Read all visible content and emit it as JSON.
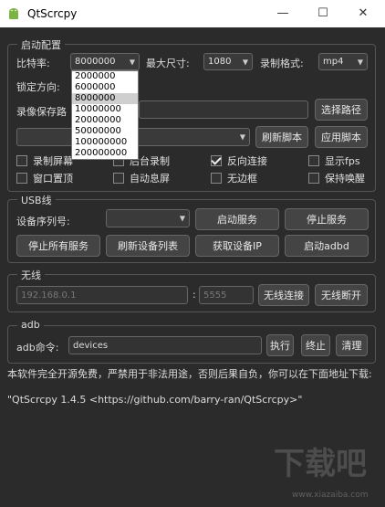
{
  "window": {
    "title": "QtScrcpy",
    "minimize": "—",
    "maximize": "☐",
    "close": "✕"
  },
  "start_group": {
    "label": "启动配置",
    "bitrate_label": "比特率:",
    "bitrate_value": "8000000",
    "bitrate_options": [
      "2000000",
      "6000000",
      "8000000",
      "10000000",
      "20000000",
      "50000000",
      "100000000",
      "200000000"
    ],
    "max_size_label": "最大尺寸:",
    "max_size_value": "1080",
    "record_format_label": "录制格式:",
    "record_format_value": "mp4",
    "lock_direction_label": "锁定方向:",
    "record_path_label": "录像保存路",
    "select_path_button": "选择路径",
    "refresh_script_button": "刷新脚本",
    "apply_script_button": "应用脚本",
    "checkboxes": {
      "record_screen": "录制屏幕",
      "background_record": "后台录制",
      "reverse_connect": "反向连接",
      "show_fps": "显示fps",
      "window_top": "窗口置顶",
      "auto_screen_off": "自动息屏",
      "frameless": "无边框",
      "keep_awake": "保持唤醒"
    }
  },
  "usb_group": {
    "label": "USB线",
    "serial_label": "设备序列号:",
    "start_service": "启动服务",
    "stop_service": "停止服务",
    "stop_all": "停止所有服务",
    "refresh_devices": "刷新设备列表",
    "get_ip": "获取设备IP",
    "start_adbd": "启动adbd"
  },
  "wireless_group": {
    "label": "无线",
    "ip_placeholder": "192.168.0.1",
    "colon": ":",
    "port_placeholder": "5555",
    "connect": "无线连接",
    "disconnect": "无线断开"
  },
  "adb_group": {
    "label": "adb",
    "command_label": "adb命令:",
    "command_value": "devices",
    "execute": "执行",
    "terminate": "终止",
    "clear": "清理"
  },
  "log": {
    "line1": "本软件完全开源免费，严禁用于非法用途，否则后果自负，你可以在下面地址下载:",
    "line2": "\"QtScrcpy 1.4.5 <https://github.com/barry-ran/QtScrcpy>\""
  },
  "watermark": {
    "text": "下载吧",
    "sub": "www.xiazaiba.com"
  },
  "colors": {
    "background": "#2b2b2b",
    "button": "#444444",
    "border": "#666666"
  }
}
